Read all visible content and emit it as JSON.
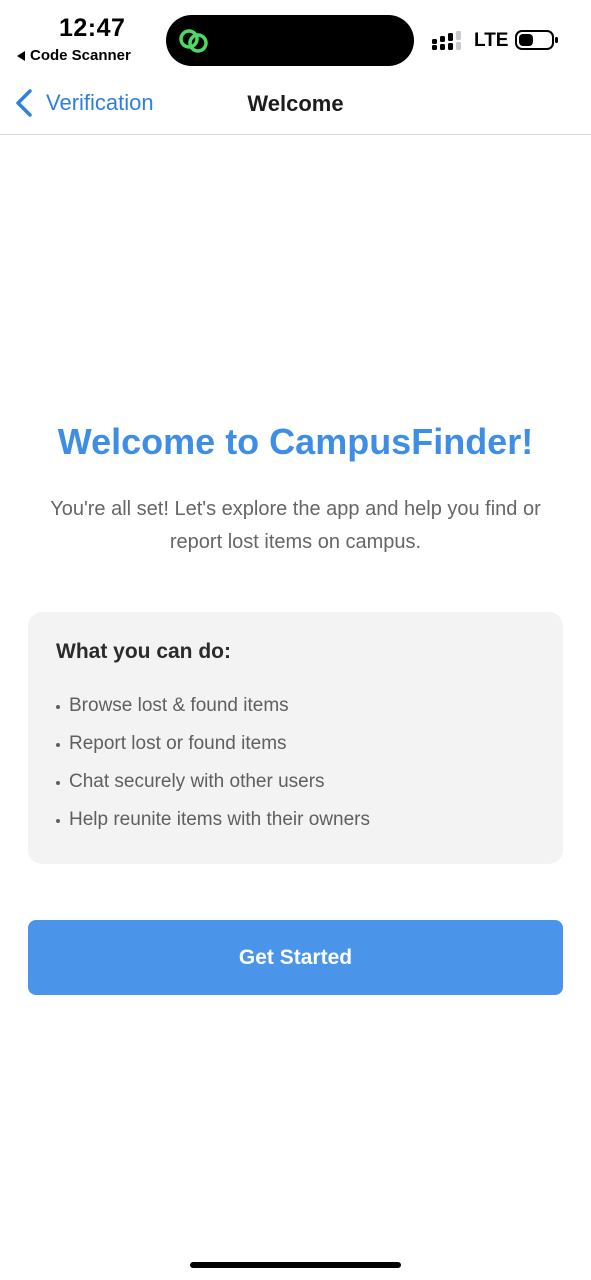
{
  "status_bar": {
    "time": "12:47",
    "back_app": "Code Scanner",
    "network": "LTE",
    "icons": [
      "link-icon",
      "signal-icon",
      "battery-icon"
    ],
    "island_icon_color": "#4cd964"
  },
  "nav": {
    "back_label": "Verification",
    "title": "Welcome",
    "accent_color": "#2f7fe0"
  },
  "main": {
    "headline": "Welcome to CampusFinder!",
    "subtitle": "You're all set! Let's explore the app and help you find or report lost items on campus.",
    "card": {
      "title": "What you can do:",
      "items": [
        "Browse lost & found items",
        "Report lost or found items",
        "Chat securely with other users",
        "Help reunite items with their owners"
      ]
    },
    "cta_label": "Get Started",
    "headline_color": "#3f8ee6",
    "cta_color": "#4a95e9"
  }
}
